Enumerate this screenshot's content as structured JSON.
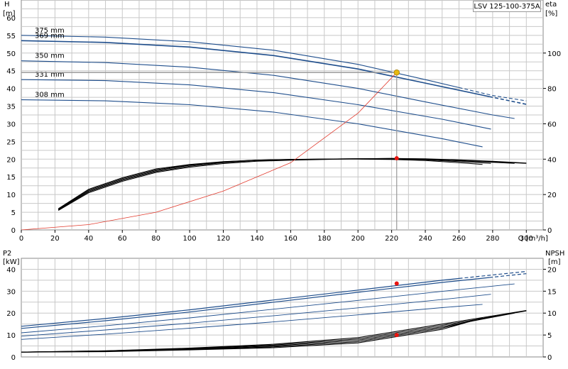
{
  "model_label": "LSV 125-100-375A",
  "colors": {
    "curve": "#1f4e8c",
    "system": "#e23b2e",
    "efficiency": "#000000",
    "point": "#e8b90f",
    "grid": "#c8c8c8"
  },
  "chart_data": [
    {
      "type": "line",
      "name": "head_efficiency",
      "axes": {
        "x": {
          "label": "Q [m³/h]",
          "range": [
            0,
            310
          ],
          "ticks": [
            "0",
            "20",
            "40",
            "60",
            "80",
            "100",
            "120",
            "140",
            "160",
            "180",
            "200",
            "220",
            "240",
            "260",
            "280",
            "300"
          ]
        },
        "y_left": {
          "label_top": "H",
          "label_bottom": "[m]",
          "range": [
            0,
            65
          ],
          "ticks": [
            "0",
            "5",
            "10",
            "15",
            "20",
            "25",
            "30",
            "35",
            "40",
            "45",
            "50",
            "55",
            "60"
          ]
        },
        "y_right": {
          "label_top": "eta",
          "label_bottom": "[%]",
          "range": [
            0,
            130
          ],
          "ticks": [
            "0",
            "20",
            "40",
            "60",
            "80",
            "100"
          ]
        }
      },
      "grid": true,
      "head_curves": [
        {
          "label": "375 mm",
          "x": [
            0,
            50,
            100,
            150,
            200,
            240,
            280,
            300
          ],
          "y": [
            55,
            54.5,
            53.2,
            50.8,
            46.8,
            42.5,
            38,
            36.5
          ],
          "dashed_from": 260
        },
        {
          "label": "369 mm",
          "x": [
            0,
            50,
            100,
            150,
            200,
            240,
            280,
            300
          ],
          "y": [
            53.5,
            53,
            51.7,
            49.3,
            45.5,
            41.5,
            37.5,
            35.5
          ],
          "dashed_from": 278
        },
        {
          "label": "350 mm",
          "x": [
            0,
            50,
            100,
            150,
            200,
            240,
            280,
            293
          ],
          "y": [
            47.8,
            47.3,
            46,
            43.7,
            40,
            36.2,
            32.5,
            31.5
          ],
          "dashed_from": null
        },
        {
          "label": "331 mm",
          "x": [
            0,
            50,
            100,
            150,
            200,
            250,
            279
          ],
          "y": [
            42.5,
            42.2,
            41,
            38.8,
            35.4,
            31.3,
            28.5
          ],
          "dashed_from": null
        },
        {
          "label": "308 mm",
          "x": [
            0,
            50,
            100,
            150,
            200,
            250,
            274
          ],
          "y": [
            36.8,
            36.5,
            35.4,
            33.3,
            30,
            25.8,
            23.5
          ],
          "dashed_from": null
        }
      ],
      "system_curve": {
        "x": [
          0,
          40,
          80,
          120,
          160,
          200,
          223
        ],
        "y": [
          0,
          1.5,
          5,
          11,
          19,
          33,
          44.5
        ]
      },
      "efficiency_curves": [
        {
          "x": [
            22,
            40,
            60,
            80,
            100,
            120,
            140,
            160,
            180,
            200,
            220,
            240,
            260,
            280,
            300
          ],
          "y": [
            11,
            21,
            27.5,
            32.5,
            35.5,
            37.5,
            38.8,
            39.4,
            39.8,
            40.2,
            40.4,
            40.2,
            39.6,
            38.8,
            37.8
          ]
        },
        {
          "x": [
            22,
            40,
            60,
            80,
            100,
            120,
            140,
            160,
            180,
            200,
            220,
            240,
            260,
            280,
            300
          ],
          "y": [
            11.3,
            21.5,
            28,
            33,
            36,
            38,
            39.2,
            39.6,
            40,
            40.3,
            40.4,
            40.1,
            39.4,
            38.5,
            37.6
          ]
        },
        {
          "x": [
            22,
            40,
            60,
            80,
            100,
            120,
            140,
            160,
            180,
            200,
            220,
            240,
            260,
            280,
            293
          ],
          "y": [
            11.5,
            22,
            28.5,
            33.5,
            36.5,
            38.3,
            39.4,
            39.8,
            40.1,
            40.3,
            40.3,
            39.9,
            39.1,
            38.2,
            37.6
          ]
        },
        {
          "x": [
            22,
            40,
            60,
            80,
            100,
            120,
            140,
            160,
            180,
            200,
            220,
            240,
            260,
            279
          ],
          "y": [
            11.8,
            22.5,
            29,
            34,
            36.8,
            38.5,
            39.5,
            39.9,
            40.1,
            40.2,
            40.1,
            39.6,
            38.6,
            37.6
          ]
        },
        {
          "x": [
            22,
            40,
            60,
            80,
            100,
            120,
            140,
            160,
            180,
            200,
            220,
            240,
            260,
            274
          ],
          "y": [
            12,
            23,
            29.5,
            34.5,
            37,
            38.6,
            39.5,
            39.8,
            40,
            40,
            39.8,
            39.2,
            38,
            37
          ]
        }
      ],
      "operating_point": {
        "Q": 223,
        "H": 44.5,
        "eta": 40.5
      }
    },
    {
      "type": "line",
      "name": "power_npsh",
      "axes": {
        "y_left": {
          "label_top": "P2",
          "label_bottom": "[kW]",
          "range": [
            0,
            45
          ],
          "ticks": [
            "0",
            "10",
            "20",
            "30",
            "40"
          ]
        },
        "y_right": {
          "label_top": "NPSH",
          "label_bottom": "[m]",
          "range": [
            0,
            22.5
          ],
          "ticks": [
            "0",
            "5",
            "10",
            "15",
            "20"
          ]
        }
      },
      "grid": true,
      "power_curves": [
        {
          "x": [
            0,
            50,
            100,
            150,
            200,
            250,
            300
          ],
          "y": [
            14,
            17.5,
            21.5,
            26,
            30.5,
            35,
            39
          ],
          "dashed_from": 260
        },
        {
          "x": [
            0,
            50,
            100,
            150,
            200,
            250,
            300
          ],
          "y": [
            13,
            16.5,
            20.5,
            25,
            29.5,
            34,
            38
          ],
          "dashed_from": 278
        },
        {
          "x": [
            0,
            50,
            100,
            150,
            200,
            250,
            293
          ],
          "y": [
            11,
            14.2,
            17.8,
            21.8,
            25.8,
            29.9,
            33.3
          ],
          "dashed_from": null
        },
        {
          "x": [
            0,
            50,
            100,
            150,
            200,
            250,
            279
          ],
          "y": [
            9.5,
            12.3,
            15.4,
            18.8,
            22.4,
            26.2,
            28.6
          ],
          "dashed_from": null
        },
        {
          "x": [
            0,
            50,
            100,
            150,
            200,
            250,
            274
          ],
          "y": [
            8,
            10.4,
            13.1,
            16,
            19.2,
            22.5,
            24
          ],
          "dashed_from": null
        }
      ],
      "npsh_curves": [
        {
          "x": [
            0,
            50,
            100,
            150,
            200,
            250,
            300
          ],
          "y": [
            1.1,
            1.4,
            2,
            2.9,
            4.4,
            7.5,
            10.6
          ]
        },
        {
          "x": [
            0,
            50,
            100,
            150,
            200,
            250,
            300
          ],
          "y": [
            1.1,
            1.4,
            1.9,
            2.7,
            4.1,
            7.2,
            10.5
          ]
        },
        {
          "x": [
            0,
            50,
            100,
            150,
            200,
            250,
            293
          ],
          "y": [
            1.1,
            1.3,
            1.8,
            2.5,
            3.8,
            6.9,
            10
          ]
        },
        {
          "x": [
            0,
            50,
            100,
            150,
            200,
            250,
            279
          ],
          "y": [
            1.1,
            1.3,
            1.7,
            2.3,
            3.5,
            6.6,
            9.2
          ]
        },
        {
          "x": [
            0,
            50,
            100,
            150,
            200,
            250,
            274
          ],
          "y": [
            1.1,
            1.2,
            1.6,
            2.1,
            3.2,
            6.3,
            8.9
          ]
        }
      ],
      "operating_point": {
        "Q": 223,
        "P2": 33.5,
        "NPSH": 5
      }
    }
  ]
}
